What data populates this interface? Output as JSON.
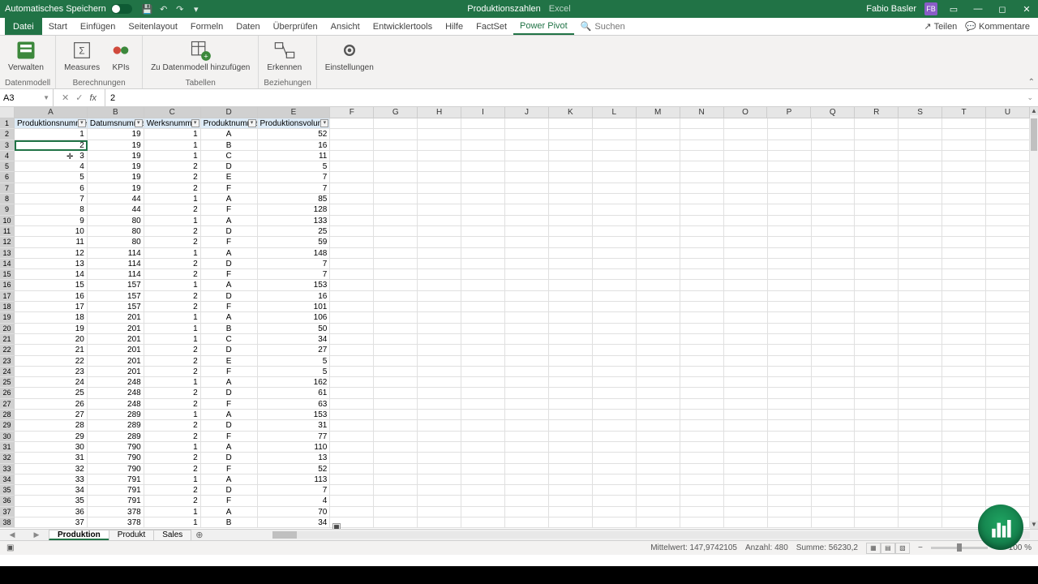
{
  "titlebar": {
    "autosave_label": "Automatisches Speichern",
    "doc_title": "Produktionszahlen",
    "app_name": "Excel",
    "user_name": "Fabio Basler",
    "user_initials": "FB"
  },
  "menu": {
    "file": "Datei",
    "tabs": [
      "Start",
      "Einfügen",
      "Seitenlayout",
      "Formeln",
      "Daten",
      "Überprüfen",
      "Ansicht",
      "Entwicklertools",
      "Hilfe",
      "FactSet",
      "Power Pivot"
    ],
    "active_tab": "Power Pivot",
    "search": "Suchen",
    "share": "Teilen",
    "comments": "Kommentare"
  },
  "ribbon": {
    "g1_label": "Datenmodell",
    "g1_btn": "Verwalten",
    "g2_label": "Berechnungen",
    "g2_btn1": "Measures",
    "g2_btn2": "KPIs",
    "g3_label": "Tabellen",
    "g3_btn": "Zu Datenmodell hinzufügen",
    "g4_label": "Beziehungen",
    "g4_btn": "Erkennen",
    "g5_btn": "Einstellungen"
  },
  "formulabar": {
    "cell_ref": "A3",
    "formula": "2"
  },
  "columns": {
    "letters": [
      "A",
      "B",
      "C",
      "D",
      "E",
      "F",
      "G",
      "H",
      "I",
      "J",
      "K",
      "L",
      "M",
      "N",
      "O",
      "P",
      "Q",
      "R",
      "S",
      "T",
      "U"
    ],
    "widths": [
      90,
      70,
      70,
      70,
      90,
      54,
      54,
      54,
      54,
      54,
      54,
      54,
      54,
      54,
      54,
      54,
      54,
      54,
      54,
      54,
      54
    ]
  },
  "headers": [
    "Produktionsnummer",
    "Datumsnummer",
    "Werksnummer",
    "Produktnummer",
    "Produktionsvolumen"
  ],
  "chart_data": {
    "type": "table",
    "active_row": 3,
    "rows": [
      {
        "A": 1,
        "B": 19,
        "C": 1,
        "D": "A",
        "E": 52
      },
      {
        "A": 2,
        "B": 19,
        "C": 1,
        "D": "B",
        "E": 16
      },
      {
        "A": 3,
        "B": 19,
        "C": 1,
        "D": "C",
        "E": 11
      },
      {
        "A": 4,
        "B": 19,
        "C": 2,
        "D": "D",
        "E": 5
      },
      {
        "A": 5,
        "B": 19,
        "C": 2,
        "D": "E",
        "E": 7
      },
      {
        "A": 6,
        "B": 19,
        "C": 2,
        "D": "F",
        "E": 7
      },
      {
        "A": 7,
        "B": 44,
        "C": 1,
        "D": "A",
        "E": 85
      },
      {
        "A": 8,
        "B": 44,
        "C": 2,
        "D": "F",
        "E": 128
      },
      {
        "A": 9,
        "B": 80,
        "C": 1,
        "D": "A",
        "E": 133
      },
      {
        "A": 10,
        "B": 80,
        "C": 2,
        "D": "D",
        "E": 25
      },
      {
        "A": 11,
        "B": 80,
        "C": 2,
        "D": "F",
        "E": 59
      },
      {
        "A": 12,
        "B": 114,
        "C": 1,
        "D": "A",
        "E": 148
      },
      {
        "A": 13,
        "B": 114,
        "C": 2,
        "D": "D",
        "E": 7
      },
      {
        "A": 14,
        "B": 114,
        "C": 2,
        "D": "F",
        "E": 7
      },
      {
        "A": 15,
        "B": 157,
        "C": 1,
        "D": "A",
        "E": 153
      },
      {
        "A": 16,
        "B": 157,
        "C": 2,
        "D": "D",
        "E": 16
      },
      {
        "A": 17,
        "B": 157,
        "C": 2,
        "D": "F",
        "E": 101
      },
      {
        "A": 18,
        "B": 201,
        "C": 1,
        "D": "A",
        "E": 106
      },
      {
        "A": 19,
        "B": 201,
        "C": 1,
        "D": "B",
        "E": 50
      },
      {
        "A": 20,
        "B": 201,
        "C": 1,
        "D": "C",
        "E": 34
      },
      {
        "A": 21,
        "B": 201,
        "C": 2,
        "D": "D",
        "E": 27
      },
      {
        "A": 22,
        "B": 201,
        "C": 2,
        "D": "E",
        "E": 5
      },
      {
        "A": 23,
        "B": 201,
        "C": 2,
        "D": "F",
        "E": 5
      },
      {
        "A": 24,
        "B": 248,
        "C": 1,
        "D": "A",
        "E": 162
      },
      {
        "A": 25,
        "B": 248,
        "C": 2,
        "D": "D",
        "E": 61
      },
      {
        "A": 26,
        "B": 248,
        "C": 2,
        "D": "F",
        "E": 63
      },
      {
        "A": 27,
        "B": 289,
        "C": 1,
        "D": "A",
        "E": 153
      },
      {
        "A": 28,
        "B": 289,
        "C": 2,
        "D": "D",
        "E": 31
      },
      {
        "A": 29,
        "B": 289,
        "C": 2,
        "D": "F",
        "E": 77
      },
      {
        "A": 30,
        "B": 790,
        "C": 1,
        "D": "A",
        "E": 110
      },
      {
        "A": 31,
        "B": 790,
        "C": 2,
        "D": "D",
        "E": 13
      },
      {
        "A": 32,
        "B": 790,
        "C": 2,
        "D": "F",
        "E": 52
      },
      {
        "A": 33,
        "B": 791,
        "C": 1,
        "D": "A",
        "E": 113
      },
      {
        "A": 34,
        "B": 791,
        "C": 2,
        "D": "D",
        "E": 7
      },
      {
        "A": 35,
        "B": 791,
        "C": 2,
        "D": "F",
        "E": 4
      },
      {
        "A": 36,
        "B": 378,
        "C": 1,
        "D": "A",
        "E": 70
      },
      {
        "A": 37,
        "B": 378,
        "C": 1,
        "D": "B",
        "E": 34
      }
    ]
  },
  "sheets": {
    "tabs": [
      "Produktion",
      "Produkt",
      "Sales"
    ],
    "active": "Produktion"
  },
  "statusbar": {
    "avg_label": "Mittelwert:",
    "avg": "147,9742105",
    "count_label": "Anzahl:",
    "count": "480",
    "sum_label": "Summe:",
    "sum": "56230,2",
    "zoom": "100 %"
  }
}
